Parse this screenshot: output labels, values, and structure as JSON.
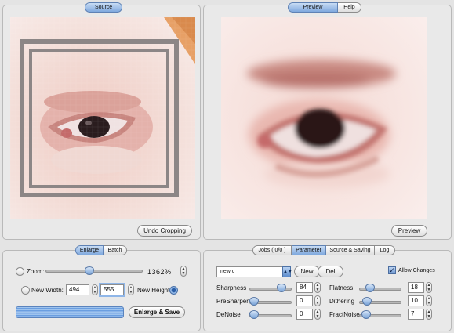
{
  "source": {
    "tab": "Source",
    "undo_label": "Undo Cropping"
  },
  "preview": {
    "tabs": [
      "Preview",
      "Help"
    ],
    "button_label": "Preview"
  },
  "enlarge": {
    "tabs": [
      "Enlarge",
      "Batch"
    ],
    "zoom_label": "Zoom:",
    "zoom_value": "1362%",
    "width_label": "New Width:",
    "width_value": "494",
    "height_value": "555",
    "height_label": "New Height",
    "enlarge_save_label": "Enlarge & Save",
    "zoom_level": 0.45
  },
  "params": {
    "tabs": [
      "Jobs ( 0/0 )",
      "Parameter",
      "Source & Saving",
      "Log"
    ],
    "preset_value": "new c",
    "new_label": "New",
    "del_label": "Del",
    "allow_changes_label": "Allow Changes",
    "sliders": [
      {
        "label": "Sharpness",
        "value": "84",
        "level": 0.84
      },
      {
        "label": "PreSharpen",
        "value": "0",
        "level": 0.0
      },
      {
        "label": "DeNoise",
        "value": "0",
        "level": 0.0
      },
      {
        "label": "Flatness",
        "value": "18",
        "level": 0.18
      },
      {
        "label": "Dithering",
        "value": "10",
        "level": 0.1
      },
      {
        "label": "FractNoise",
        "value": "7",
        "level": 0.07
      }
    ]
  },
  "colors": {
    "accent": "#7fa9de",
    "skin_light": "#f2d6cf",
    "skin_shadow": "#d49a90",
    "iris": "#2a1c1e"
  }
}
